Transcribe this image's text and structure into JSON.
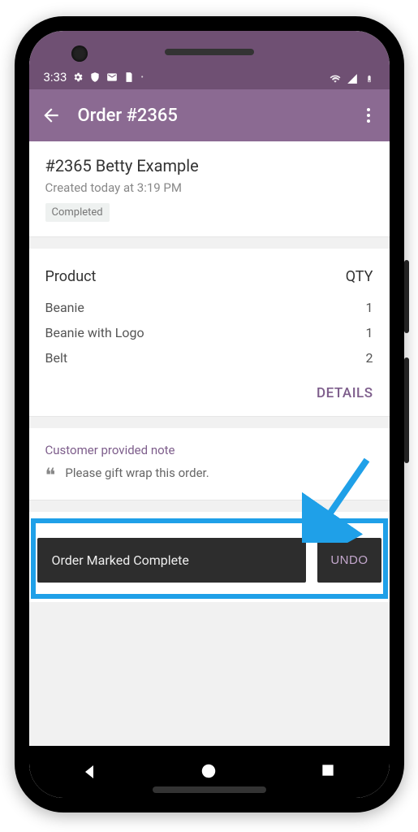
{
  "statusbar": {
    "time": "3:33"
  },
  "appbar": {
    "title": "Order #2365"
  },
  "order": {
    "title": "#2365 Betty Example",
    "created": "Created today at 3:19 PM",
    "status": "Completed"
  },
  "products": {
    "header_product": "Product",
    "header_qty": "QTY",
    "items": [
      {
        "name": "Beanie",
        "qty": "1"
      },
      {
        "name": "Beanie with Logo",
        "qty": "1"
      },
      {
        "name": "Belt",
        "qty": "2"
      }
    ],
    "details_label": "DETAILS"
  },
  "note": {
    "header": "Customer provided note",
    "body": "Please gift wrap this order."
  },
  "snackbar": {
    "message": "Order Marked Complete",
    "undo_label": "UNDO"
  }
}
